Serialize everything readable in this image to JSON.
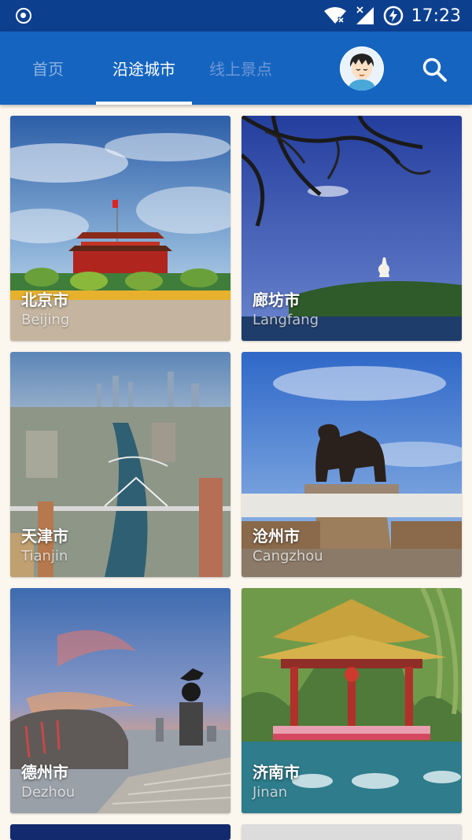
{
  "status_bar": {
    "time": "17:23",
    "icons": [
      "record-icon",
      "wifi-icon",
      "signal-icon",
      "battery-charging-icon"
    ]
  },
  "app_bar": {
    "tabs": [
      {
        "label": "首页",
        "active": false
      },
      {
        "label": "沿途城市",
        "active": true
      },
      {
        "label": "线上景点",
        "active": false
      }
    ],
    "avatar_icon": "avatar",
    "search_icon": "search-icon"
  },
  "cities": [
    {
      "name": "北京市",
      "pinyin": "Beijing"
    },
    {
      "name": "廊坊市",
      "pinyin": "Langfang"
    },
    {
      "name": "天津市",
      "pinyin": "Tianjin"
    },
    {
      "name": "沧州市",
      "pinyin": "Cangzhou"
    },
    {
      "name": "德州市",
      "pinyin": "Dezhou"
    },
    {
      "name": "济南市",
      "pinyin": "Jinan"
    }
  ],
  "colors": {
    "status_bar": "#0d3f8f",
    "app_bar": "#1565c0",
    "background": "#fbf6ee"
  }
}
